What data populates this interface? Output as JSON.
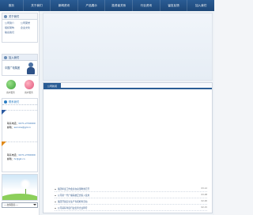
{
  "topnav": {
    "items": [
      "首页",
      "关于我们",
      "新闻资讯",
      "产品展示",
      "投资者关系",
      "行业资讯",
      "留言反馈",
      "加入我们"
    ]
  },
  "sidebar": {
    "about": {
      "title": "关于我们",
      "links": [
        "公司简介",
        "公司荣誉",
        "组织架构",
        "企业文化",
        "联系我们"
      ]
    },
    "join": {
      "title": "加入我们",
      "text": "中国广电集团"
    },
    "services": [
      {
        "label": "用户服务",
        "icon": "leaf-icon"
      },
      {
        "label": "用户服务",
        "icon": "heart-icon"
      }
    ],
    "contacts": {
      "title": "联系我们",
      "blocks": [
        {
          "line1_key": "联系电话：",
          "line1_val": "0271-2710000",
          "line2_key": "邮箱：",
          "line2_val": "service@gd.cn"
        },
        {
          "line1_key": "联系电话：",
          "line1_val": "0271-2720000",
          "line2_key": "邮箱：",
          "line2_val": "hr@gd.cn"
        }
      ]
    },
    "select": {
      "value": "----友情链接----"
    }
  },
  "main": {
    "tab_label": "公司新闻",
    "news": [
      {
        "title": "集团年度工作会议在总部隆重召开",
        "date": "03-12"
      },
      {
        "title": "公司新一代广播系统正式投入使用",
        "date": "03-08"
      },
      {
        "title": "集团开展安全生产专项检查活动",
        "date": "02-26"
      },
      {
        "title": "公司荣获年度行业优秀企业称号",
        "date": "02-15"
      }
    ]
  }
}
